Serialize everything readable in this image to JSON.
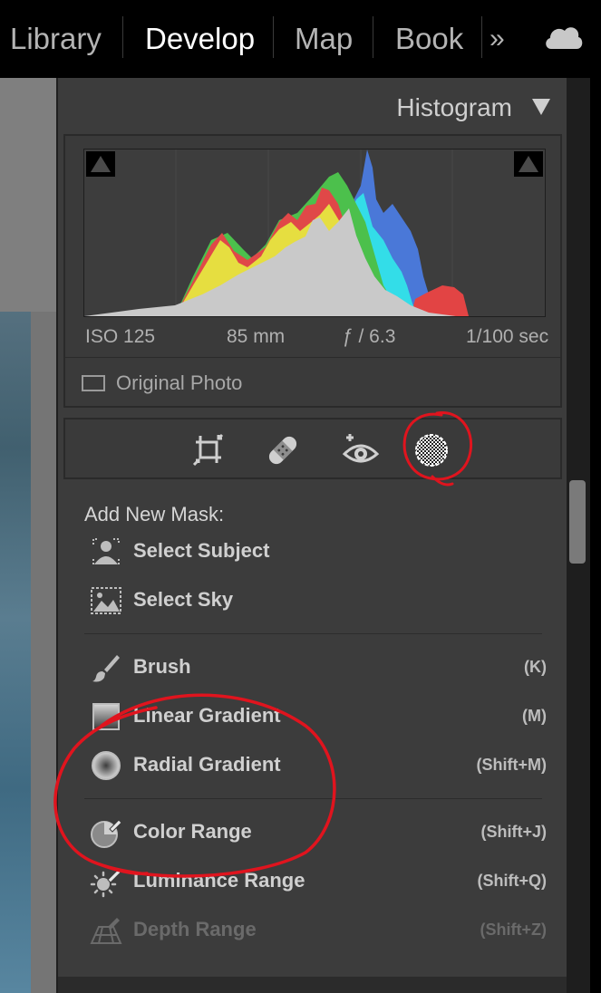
{
  "topbar": {
    "modules": [
      "Library",
      "Develop",
      "Map",
      "Book"
    ],
    "active_module": "Develop",
    "more_icon": "double-chevron-right-icon",
    "cloud_icon": "cloud-icon"
  },
  "histogram": {
    "title": "Histogram",
    "iso": "ISO 125",
    "focal_length": "85 mm",
    "aperture": "ƒ / 6.3",
    "shutter": "1/100 sec",
    "original_photo_label": "Original Photo"
  },
  "tools": {
    "icons": [
      "crop-icon",
      "healing-icon",
      "red-eye-icon",
      "masking-icon"
    ]
  },
  "masks": {
    "heading": "Add New Mask:",
    "items": [
      {
        "label": "Select Subject",
        "shortcut": "",
        "icon": "select-subject-icon"
      },
      {
        "label": "Select Sky",
        "shortcut": "",
        "icon": "select-sky-icon"
      },
      {
        "label": "Brush",
        "shortcut": "(K)",
        "icon": "brush-icon"
      },
      {
        "label": "Linear Gradient",
        "shortcut": "(M)",
        "icon": "linear-gradient-icon"
      },
      {
        "label": "Radial Gradient",
        "shortcut": "(Shift+M)",
        "icon": "radial-gradient-icon"
      },
      {
        "label": "Color Range",
        "shortcut": "(Shift+J)",
        "icon": "color-range-icon"
      },
      {
        "label": "Luminance Range",
        "shortcut": "(Shift+Q)",
        "icon": "luminance-range-icon"
      },
      {
        "label": "Depth Range",
        "shortcut": "(Shift+Z)",
        "icon": "depth-range-icon"
      }
    ]
  },
  "colors": {
    "accent_annotation": "#e0141e",
    "panel_bg": "#3c3c3c",
    "topbar_bg": "#000000"
  }
}
